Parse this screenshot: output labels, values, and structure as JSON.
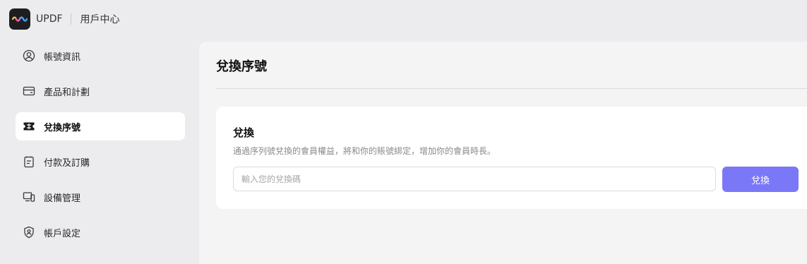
{
  "header": {
    "app_name": "UPDF",
    "center_title": "用戶中心",
    "logo_icon": "updf-wave-logo"
  },
  "sidebar": {
    "items": [
      {
        "label": "帳號資訊",
        "icon": "user-circle-icon",
        "active": false
      },
      {
        "label": "產品和計劃",
        "icon": "wallet-icon",
        "active": false
      },
      {
        "label": "兌換序號",
        "icon": "ticket-icon",
        "active": true
      },
      {
        "label": "付款及訂購",
        "icon": "receipt-icon",
        "active": false
      },
      {
        "label": "設備管理",
        "icon": "devices-icon",
        "active": false
      },
      {
        "label": "帳戶設定",
        "icon": "shield-user-icon",
        "active": false
      }
    ]
  },
  "main": {
    "page_title": "兌換序號",
    "card": {
      "title": "兌換",
      "description": "通過序列號兌換的會員權益，將和你的賬號綁定，增加你的會員時長。",
      "input_placeholder": "輸入您的兌換碼",
      "input_value": "",
      "button_label": "兌換"
    }
  },
  "colors": {
    "accent": "#7b78f8",
    "page_bg": "#ececee",
    "panel_bg": "#f4f4f5",
    "card_bg": "#ffffff"
  }
}
